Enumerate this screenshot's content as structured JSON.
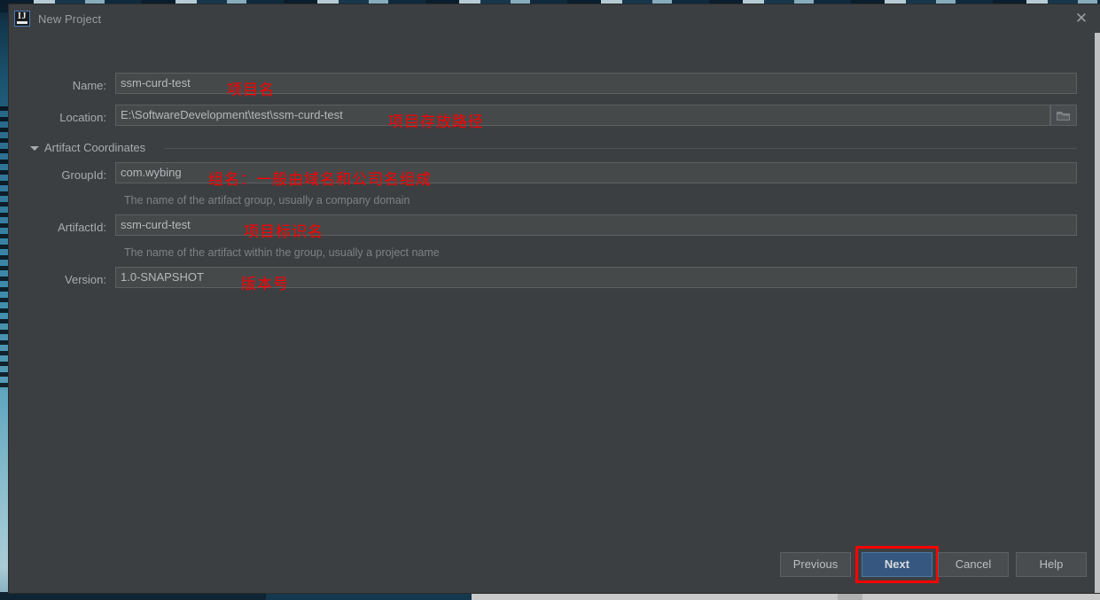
{
  "window": {
    "title": "New Project",
    "app_icon": "intellij-idea-logo",
    "close_icon": "✕"
  },
  "form": {
    "name": {
      "label": "Name:",
      "value": "ssm-curd-test",
      "annotation": "项目名"
    },
    "location": {
      "label": "Location:",
      "value": "E:\\SoftwareDevelopment\\test\\ssm-curd-test",
      "annotation": "项目存放路径",
      "browse_icon": "folder-icon"
    },
    "section": {
      "label": "Artifact Coordinates",
      "caret_icon": "caret-down-icon"
    },
    "group_id": {
      "label": "GroupId:",
      "value": "com.wybing",
      "helper": "The name of the artifact group, usually a company domain",
      "annotation": "组名：一般由域名和公司名组成"
    },
    "artifact_id": {
      "label": "ArtifactId:",
      "value": "ssm-curd-test",
      "helper": "The name of the artifact within the group, usually a project name",
      "annotation": "项目标识名"
    },
    "version": {
      "label": "Version:",
      "value": "1.0-SNAPSHOT",
      "annotation": "版本号"
    }
  },
  "buttons": {
    "previous": "Previous",
    "next": "Next",
    "cancel": "Cancel",
    "help": "Help"
  },
  "colors": {
    "dialog_bg": "#3c3f41",
    "input_bg": "#45494a",
    "primary_button": "#365880",
    "annotation_red": "#ff0000",
    "label_text": "#a9abad",
    "helper_text": "#7e8184"
  }
}
